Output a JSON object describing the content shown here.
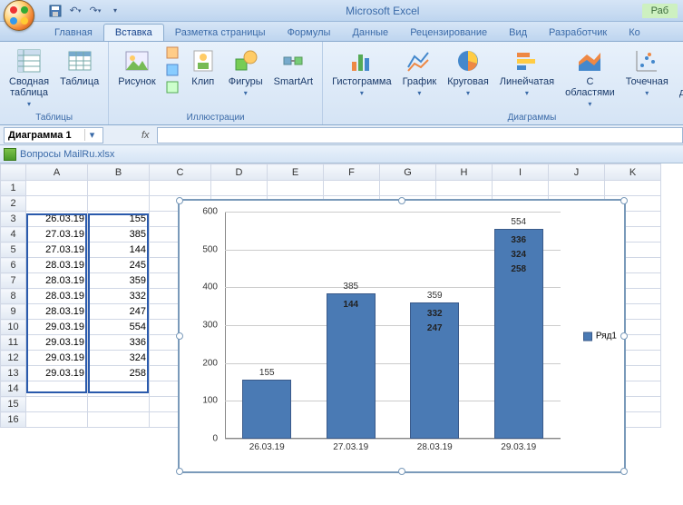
{
  "app_title": "Microsoft Excel",
  "context_tab": "Раб",
  "tabs": [
    "Главная",
    "Вставка",
    "Разметка страницы",
    "Формулы",
    "Данные",
    "Рецензирование",
    "Вид",
    "Разработчик",
    "Ко"
  ],
  "active_tab_index": 1,
  "ribbon": {
    "groups": [
      {
        "label": "Таблицы",
        "buttons": [
          {
            "name": "pivot",
            "label": "Сводная\nтаблица",
            "dd": true
          },
          {
            "name": "table",
            "label": "Таблица"
          }
        ]
      },
      {
        "label": "Иллюстрации",
        "buttons": [
          {
            "name": "picture",
            "label": "Рисунок"
          },
          {
            "name": "clip",
            "label": "Клип"
          },
          {
            "name": "shapes",
            "label": "Фигуры",
            "dd": true
          },
          {
            "name": "smartart",
            "label": "SmartArt"
          }
        ]
      },
      {
        "label": "Диаграммы",
        "buttons": [
          {
            "name": "column-chart",
            "label": "Гистограмма",
            "dd": true
          },
          {
            "name": "line-chart",
            "label": "График",
            "dd": true
          },
          {
            "name": "pie-chart",
            "label": "Круговая",
            "dd": true
          },
          {
            "name": "bar-chart",
            "label": "Линейчатая",
            "dd": true
          },
          {
            "name": "area-chart",
            "label": "С\nобластями",
            "dd": true
          },
          {
            "name": "scatter-chart",
            "label": "Точечная",
            "dd": true
          },
          {
            "name": "other-chart",
            "label": "Другие\nдиаграммы",
            "dd": true
          }
        ]
      }
    ],
    "illust_small": [
      "",
      "",
      ""
    ]
  },
  "namebox": "Диаграмма 1",
  "fx_label": "fx",
  "workbook": "Вопросы MailRu.xlsx",
  "columns": [
    "A",
    "B",
    "C",
    "D",
    "E",
    "F",
    "G",
    "H",
    "I",
    "J",
    "K"
  ],
  "rows": [
    {
      "r": 1,
      "a": "",
      "b": ""
    },
    {
      "r": 2,
      "a": "",
      "b": ""
    },
    {
      "r": 3,
      "a": "26.03.19",
      "b": "155"
    },
    {
      "r": 4,
      "a": "27.03.19",
      "b": "385"
    },
    {
      "r": 5,
      "a": "27.03.19",
      "b": "144"
    },
    {
      "r": 6,
      "a": "28.03.19",
      "b": "245"
    },
    {
      "r": 7,
      "a": "28.03.19",
      "b": "359"
    },
    {
      "r": 8,
      "a": "28.03.19",
      "b": "332"
    },
    {
      "r": 9,
      "a": "28.03.19",
      "b": "247"
    },
    {
      "r": 10,
      "a": "29.03.19",
      "b": "554"
    },
    {
      "r": 11,
      "a": "29.03.19",
      "b": "336"
    },
    {
      "r": 12,
      "a": "29.03.19",
      "b": "324"
    },
    {
      "r": 13,
      "a": "29.03.19",
      "b": "258"
    },
    {
      "r": 14,
      "a": "",
      "b": ""
    },
    {
      "r": 15,
      "a": "",
      "b": ""
    },
    {
      "r": 16,
      "a": "",
      "b": ""
    }
  ],
  "chart_data": {
    "type": "bar",
    "categories": [
      "26.03.19",
      "27.03.19",
      "28.03.19",
      "29.03.19"
    ],
    "values": [
      155,
      385,
      359,
      554
    ],
    "inner_labels": [
      [],
      [
        "144"
      ],
      [
        "332",
        "247"
      ],
      [
        "336",
        "324",
        "258"
      ]
    ],
    "legend": "Ряд1",
    "ylim": [
      0,
      600
    ],
    "yticks": [
      0,
      100,
      200,
      300,
      400,
      500,
      600
    ]
  }
}
